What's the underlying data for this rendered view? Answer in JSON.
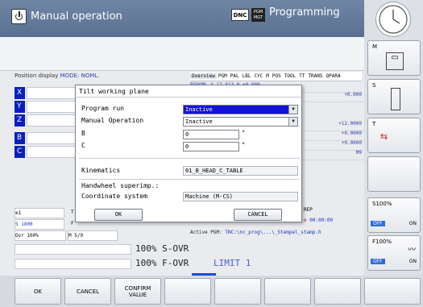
{
  "header": {
    "left_mode": "Manual operation",
    "dnc": "DNC",
    "pgm_badge": "PGM MGT",
    "right_mode": "Programming"
  },
  "position": {
    "label": "Position display",
    "mode": "MODE: NOML.",
    "axes": [
      "X",
      "Y",
      "Z",
      "B",
      "C"
    ]
  },
  "overview_tabs": [
    "Overview",
    "PGM",
    "PAL",
    "LBL",
    "CYC",
    "M",
    "POS",
    "TOOL",
    "TT",
    "TRANS",
    "QPARA"
  ],
  "overview_rows": {
    "r1": "RENOML X   17.813   0   +0.000",
    "r2": "+0.000",
    "r3": "+12.0000",
    "r4": "+0.0000",
    "r5": "+0.0000",
    "r6": "M9",
    "rep": "REP",
    "time": "00:00:00"
  },
  "dialog": {
    "title": "Tilt working plane",
    "program_run_label": "Program run",
    "program_run_value": "Inactive",
    "manual_op_label": "Manual Operation",
    "manual_op_value": "Inactive",
    "b_label": "B",
    "b_value": "0",
    "c_label": "C",
    "c_value": "0",
    "unit": "°",
    "kinematics_label": "Kinematics",
    "kinematics_value": "01_B_HEAD_C_TABLE",
    "handwheel_label": "Handwheel superimp.:",
    "coord_label": "Coordinate system",
    "coord_value": "Machine (M-CS)",
    "ok": "OK",
    "cancel": "CANCEL"
  },
  "lower_status": {
    "t_row": "T",
    "s_value": "S 1800",
    "f_label": "F",
    "ovr": "Ovr 100%",
    "m_value": "M 5/9",
    "spindle_idx": "1"
  },
  "active_pgm": {
    "label": "Active PGM:",
    "path": "TNC:\\nc_prog\\...\\_Stempel_stamp.h"
  },
  "overrides": {
    "s_ovr": "100% S-OVR",
    "f_ovr": "100% F-OVR",
    "limit": "LIMIT 1"
  },
  "right_softkeys": {
    "m": "M",
    "s": "S",
    "t": "T",
    "s100": "S100%",
    "off1": "OFF",
    "on1": "ON",
    "f100": "F100%",
    "off2": "OFF",
    "on2": "ON"
  },
  "bottom_softkeys": [
    "OK",
    "CANCEL",
    "CONFIRM\nVALUE",
    "",
    "",
    "",
    "",
    ""
  ],
  "colors": {
    "axis_blue": "#0a1fbf",
    "active_select": "#1313d8",
    "header": "#6f86a6",
    "off_badge": "#2f6de0"
  }
}
